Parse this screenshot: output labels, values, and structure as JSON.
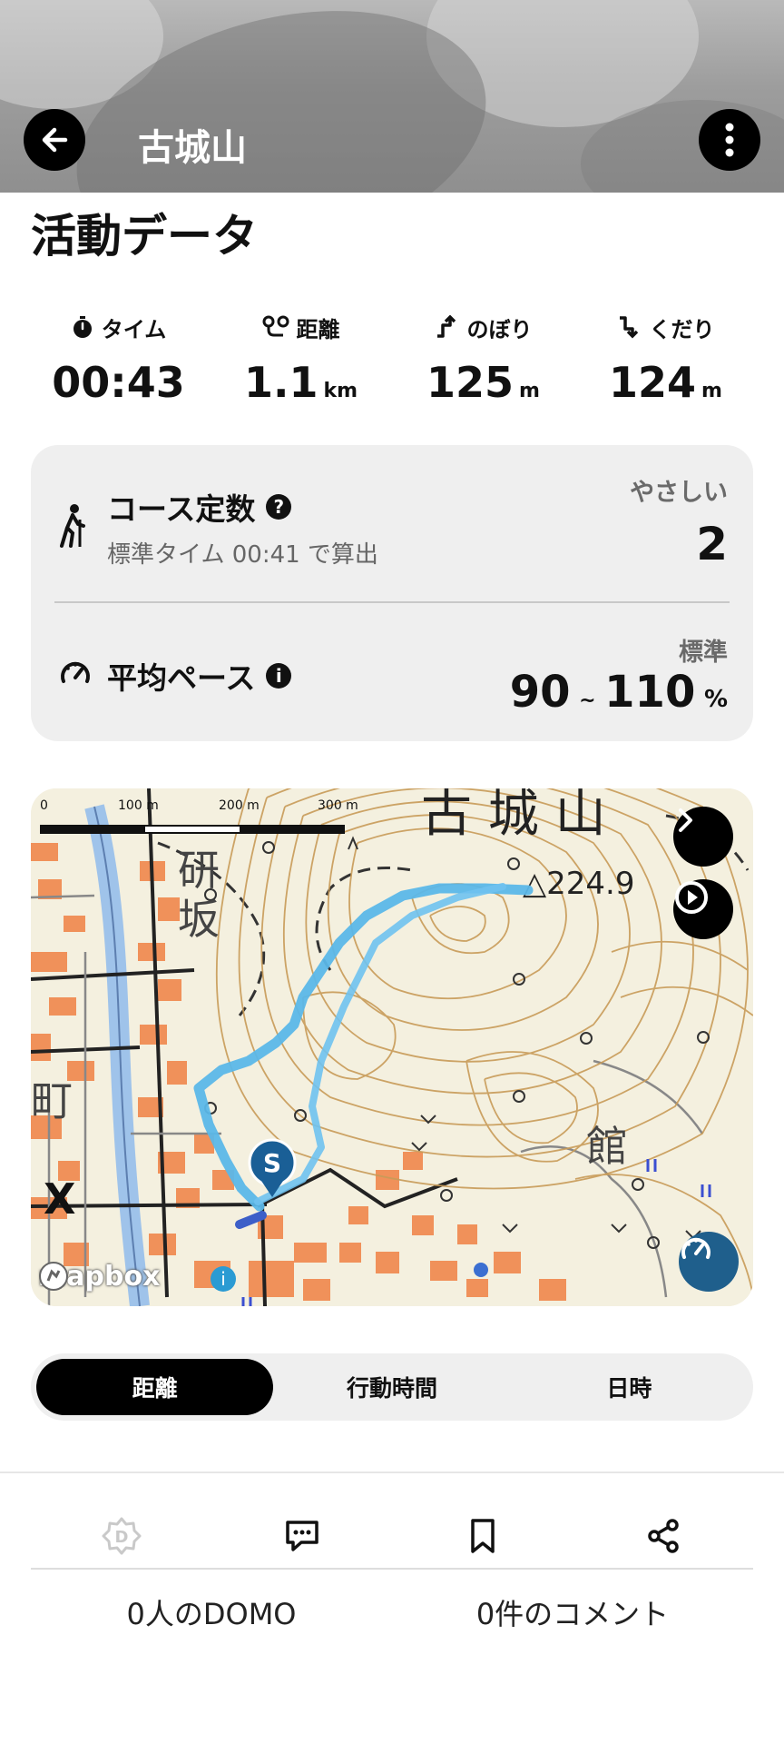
{
  "header": {
    "title": "古城山",
    "back_icon": "arrow-left-icon",
    "more_icon": "vertical-dots-icon"
  },
  "section": {
    "title": "活動データ"
  },
  "stats": [
    {
      "label": "タイム",
      "value": "00:43",
      "unit": "",
      "icon": "stopwatch-icon"
    },
    {
      "label": "距離",
      "value": "1.1",
      "unit": "km",
      "icon": "route-icon"
    },
    {
      "label": "のぼり",
      "value": "125",
      "unit": "m",
      "icon": "ascent-icon"
    },
    {
      "label": "くだり",
      "value": "124",
      "unit": "m",
      "icon": "descent-icon"
    }
  ],
  "course": {
    "label": "コース定数",
    "help_glyph": "?",
    "sub": "標準タイム 00:41 で算出",
    "difficulty": "やさしい",
    "value": "2"
  },
  "pace": {
    "label": "平均ペース",
    "info_glyph": "i",
    "level": "標準",
    "low": "90",
    "sep": "~",
    "high": "110",
    "unit": "%"
  },
  "map": {
    "scale_labels": [
      "0",
      "100 m",
      "200 m",
      "300 m"
    ],
    "place_labels": [
      "古 城 山",
      "研",
      "坂",
      "町",
      "館",
      "△224.9",
      "X"
    ],
    "start_marker": "S",
    "attribution": "mapbox",
    "info_glyph": "i",
    "accent": "#5bb7e8"
  },
  "tabs": [
    {
      "label": "距離",
      "active": true
    },
    {
      "label": "行動時間",
      "active": false
    },
    {
      "label": "日時",
      "active": false
    }
  ],
  "actions": {
    "icons": [
      "domo-icon",
      "comment-icon",
      "bookmark-icon",
      "share-icon"
    ],
    "domo_count": "0人のDOMO",
    "comment_count": "0件のコメント"
  }
}
